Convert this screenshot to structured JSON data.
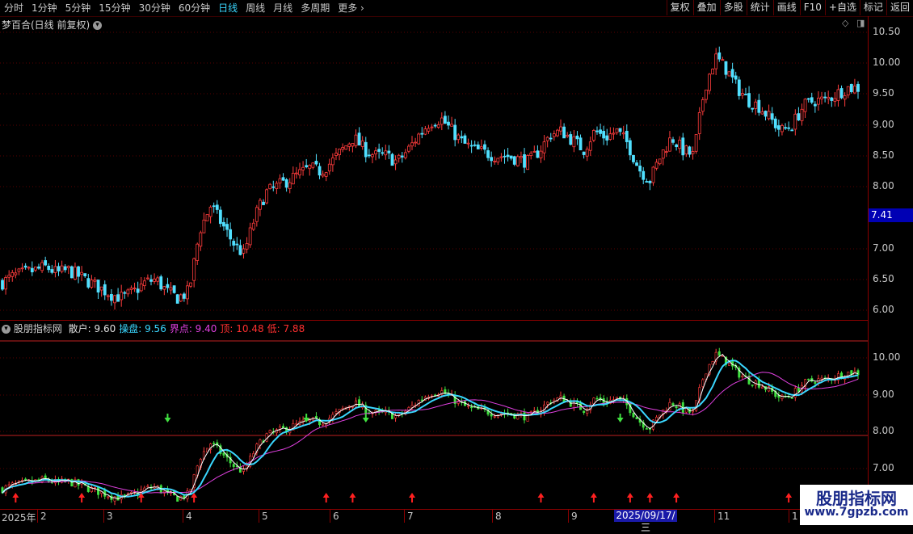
{
  "toolbar": {
    "periods": [
      "分时",
      "1分钟",
      "5分钟",
      "15分钟",
      "30分钟",
      "60分钟",
      "日线",
      "周线",
      "月线",
      "多周期",
      "更多"
    ],
    "active_index": 6,
    "more_arrow": "›",
    "buttons": [
      "复权",
      "叠加",
      "多股",
      "统计",
      "画线",
      "F10",
      "+自选",
      "标记",
      "返回"
    ]
  },
  "main_panel": {
    "title": "梦百合(日线 前复权)",
    "icons": [
      "chevron-down-icon",
      "diamond-icon",
      "panel-icon"
    ],
    "price_axis": [
      "10.50",
      "10.00",
      "9.50",
      "9.00",
      "8.50",
      "8.00",
      "7.00",
      "6.50",
      "6.00"
    ],
    "current_price_tag": "7.41"
  },
  "indicator_panel": {
    "name": "股朋指标网",
    "items": [
      {
        "label": "散户: 9.60",
        "color": "#e0e0e0"
      },
      {
        "label": "操盘: 9.56",
        "color": "#3ad7ff"
      },
      {
        "label": "界点: 9.40",
        "color": "#e040e0"
      },
      {
        "label": "顶: 10.48",
        "color": "#ff3030"
      },
      {
        "label": "低: 7.88",
        "color": "#ff3030"
      }
    ],
    "axis": [
      "10.00",
      "9.00",
      "8.00",
      "7.00"
    ]
  },
  "date_axis": {
    "labels": [
      "2025年",
      "2",
      "3",
      "4",
      "5",
      "6",
      "7",
      "8",
      "9",
      "11",
      "1"
    ],
    "cursor": "2025/09/17/三"
  },
  "watermark": {
    "title": "股朋指标网",
    "url": "www.7gpzb.com"
  },
  "chart_data": {
    "type": "candlestick",
    "title": "梦百合(日线 前复权)",
    "price_range": [
      5.9,
      10.7
    ],
    "closes_sampled": [
      6.45,
      6.55,
      6.6,
      6.65,
      6.7,
      6.6,
      6.65,
      6.55,
      6.45,
      6.35,
      6.25,
      6.2,
      6.3,
      6.45,
      6.5,
      6.3,
      6.2,
      6.3,
      7.3,
      7.7,
      7.4,
      7.1,
      6.9,
      7.5,
      7.9,
      8.0,
      8.1,
      8.2,
      8.3,
      8.25,
      8.4,
      8.6,
      8.8,
      8.6,
      8.5,
      8.5,
      8.4,
      8.6,
      8.85,
      9.05,
      9.1,
      8.9,
      8.7,
      8.6,
      8.55,
      8.5,
      8.5,
      8.45,
      8.4,
      8.6,
      8.85,
      8.9,
      8.75,
      8.6,
      8.9,
      8.8,
      8.9,
      8.7,
      8.3,
      8.1,
      8.5,
      8.8,
      8.6,
      8.5,
      9.6,
      10.1,
      9.9,
      9.6,
      9.4,
      9.3,
      9.1,
      8.9,
      9.0,
      9.3,
      9.4,
      9.4,
      9.5,
      9.6,
      9.6
    ],
    "indicator": {
      "series": [
        "散户",
        "操盘",
        "界点"
      ],
      "values": [
        9.6,
        9.56,
        9.4
      ],
      "top": 10.48,
      "bottom": 7.88
    }
  }
}
